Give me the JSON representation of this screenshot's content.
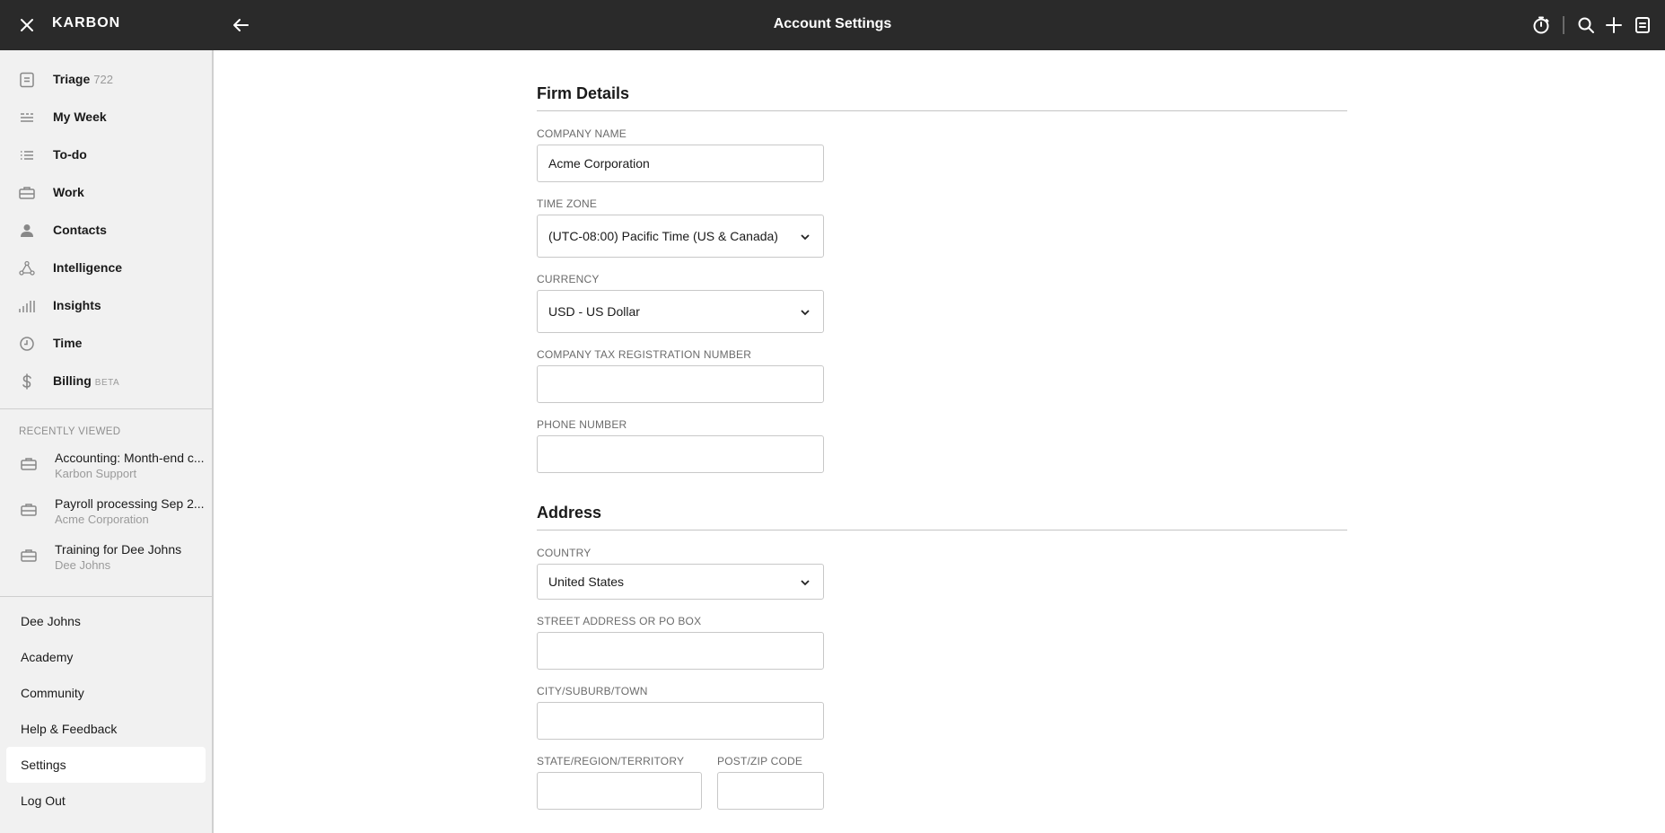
{
  "topbar": {
    "brand": "KARBON",
    "title": "Account Settings",
    "icons": [
      "close-icon",
      "back-arrow-icon",
      "timer-icon",
      "search-icon",
      "plus-icon",
      "triage-icon"
    ]
  },
  "sidebar": {
    "nav": [
      {
        "label": "Triage",
        "badge": "722",
        "icon": "triage-icon"
      },
      {
        "label": "My Week",
        "badge": "",
        "icon": "my-week-icon"
      },
      {
        "label": "To-do",
        "badge": "",
        "icon": "todo-list-icon"
      },
      {
        "label": "Work",
        "badge": "",
        "icon": "briefcase-icon"
      },
      {
        "label": "Contacts",
        "badge": "",
        "icon": "person-icon"
      },
      {
        "label": "Intelligence",
        "badge": "",
        "icon": "network-icon"
      },
      {
        "label": "Insights",
        "badge": "",
        "icon": "bar-chart-icon"
      },
      {
        "label": "Time",
        "badge": "",
        "icon": "clock-icon"
      },
      {
        "label": "Billing",
        "badge": "BETA",
        "icon": "dollar-icon"
      }
    ],
    "recent_label": "RECENTLY VIEWED",
    "recent": [
      {
        "title": "Accounting: Month-end c...",
        "subtitle": "Karbon Support"
      },
      {
        "title": "Payroll processing Sep 2...",
        "subtitle": "Acme Corporation"
      },
      {
        "title": "Training for Dee Johns",
        "subtitle": "Dee Johns"
      }
    ],
    "menu": [
      {
        "label": "Dee Johns",
        "active": false
      },
      {
        "label": "Academy",
        "active": false
      },
      {
        "label": "Community",
        "active": false
      },
      {
        "label": "Help & Feedback",
        "active": false
      },
      {
        "label": "Settings",
        "active": true
      },
      {
        "label": "Log Out",
        "active": false
      }
    ]
  },
  "main": {
    "firm": {
      "title": "Firm Details",
      "company_name_label": "COMPANY NAME",
      "company_name_value": "Acme Corporation",
      "time_zone_label": "TIME ZONE",
      "time_zone_value": "(UTC-08:00) Pacific Time (US & Canada)",
      "currency_label": "CURRENCY",
      "currency_value": "USD - US Dollar",
      "tax_label": "COMPANY TAX REGISTRATION NUMBER",
      "tax_value": "",
      "phone_label": "PHONE NUMBER",
      "phone_value": ""
    },
    "address": {
      "title": "Address",
      "country_label": "COUNTRY",
      "country_value": "United States",
      "street_label": "STREET ADDRESS OR PO BOX",
      "street_value": "",
      "city_label": "CITY/SUBURB/TOWN",
      "city_value": "",
      "state_label": "STATE/REGION/TERRITORY",
      "state_value": "",
      "zip_label": "POST/ZIP CODE",
      "zip_value": ""
    }
  }
}
